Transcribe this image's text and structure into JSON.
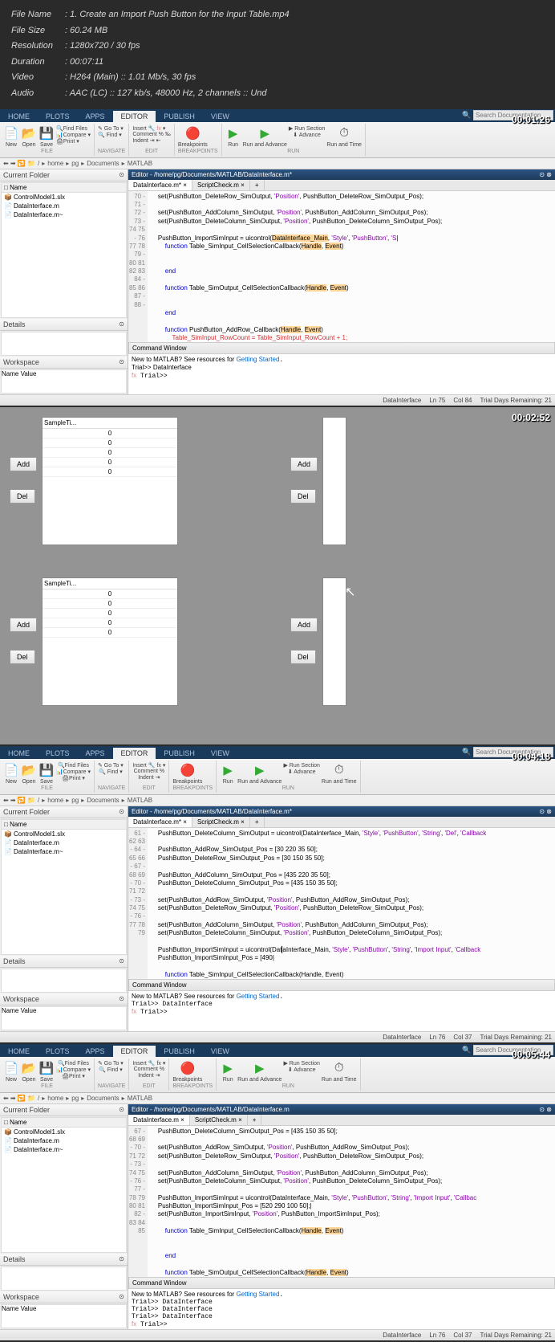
{
  "meta": {
    "fileName": "1. Create an Import Push Button for the Input Table.mp4",
    "fileSize": "60.24 MB",
    "resolution": "1280x720 / 30 fps",
    "duration": "00:07:11",
    "video": "H264 (Main) :: 1.01 Mb/s, 30 fps",
    "audio": "AAC (LC) :: 127 kb/s, 48000 Hz, 2 channels :: Und"
  },
  "tabs": [
    "HOME",
    "PLOTS",
    "APPS",
    "EDITOR",
    "PUBLISH",
    "VIEW"
  ],
  "ribbon": {
    "file": [
      "New",
      "Open",
      "Save"
    ],
    "findFiles": "Find Files",
    "compare": "Compare",
    "print": "Print",
    "goto": "Go To",
    "find": "Find",
    "insert": "Insert",
    "comment": "Comment",
    "indent": "Indent",
    "breakpoints": "Breakpoints",
    "run": "Run",
    "runAdvance": "Run and Advance",
    "runSection": "Run Section",
    "advance": "Advance",
    "runTime": "Run and Time",
    "searchPlaceholder": "Search Documentation"
  },
  "breadcrumb": [
    "/",
    "home",
    "pg",
    "Documents",
    "MATLAB"
  ],
  "currentFolder": {
    "title": "Current Folder",
    "nameHdr": "Name",
    "items": [
      "ControlModel1.slx",
      "DataInterface.m",
      "DataInterface.m~"
    ]
  },
  "details": "Details",
  "workspace": {
    "title": "Workspace",
    "name": "Name",
    "value": "Value"
  },
  "shot1": {
    "ts": "00:01:26",
    "editor": "Editor - /home/pg/Documents/MATLAB/DataInterface.m*",
    "edTabs": [
      "DataInterface.m*",
      "ScriptCheck.m"
    ],
    "lines": [
      "70",
      "71",
      "72",
      "73",
      "74",
      "75",
      "76",
      "77",
      "78",
      "79",
      "80",
      "81",
      "82",
      "83",
      "84",
      "85",
      "86",
      "87",
      "88"
    ],
    "cwTitle": "Command Window",
    "cwIntro": "New to MATLAB? See resources for ",
    "cwLink": "Getting Started",
    "cwBody": [
      " Trial>> DataInterface",
      "fx Trial>>"
    ],
    "status": {
      "script": "DataInterface",
      "ln": "Ln  75",
      "col": "Col  84",
      "trial": "Trial Days Remaining: 21"
    }
  },
  "shot2": {
    "ts": "00:02:52",
    "header": "SampleTi...",
    "vals": [
      "0",
      "0",
      "0",
      "0",
      "0"
    ],
    "add": "Add",
    "del": "Del"
  },
  "shot3": {
    "ts": "00:04:18",
    "editor": "Editor - /home/pg/Documents/MATLAB/DataInterface.m*",
    "lines": [
      "61",
      "62",
      "63",
      "64",
      "65",
      "66",
      "67",
      "68",
      "69",
      "70",
      "71",
      "72",
      "73",
      "74",
      "75",
      "76",
      "77",
      "78",
      "79"
    ],
    "cwBody": [
      "  Trial>> DataInterface",
      "fx Trial>>"
    ],
    "status": {
      "script": "DataInterface",
      "ln": "Ln  76",
      "col": "Col  37",
      "trial": "Trial Days Remaining: 21"
    }
  },
  "shot4": {
    "ts": "00:05:44",
    "editor": "Editor - /home/pg/Documents/MATLAB/DataInterface.m",
    "edTabs": [
      "DataInterface.m",
      "ScriptCheck.m"
    ],
    "lines": [
      "67",
      "68",
      "69",
      "70",
      "71",
      "72",
      "73",
      "74",
      "75",
      "76",
      "77",
      "78",
      "79",
      "80",
      "81",
      "82",
      "83",
      "84",
      "85"
    ],
    "cwBody": [
      "  Trial>> DataInterface",
      "  Trial>> DataInterface",
      "  Trial>> DataInterface",
      "fx Trial>>"
    ],
    "status": {
      "script": "DataInterface",
      "ln": "Ln  76",
      "col": "Col  37",
      "trial": "Trial Days Remaining: 21"
    }
  }
}
